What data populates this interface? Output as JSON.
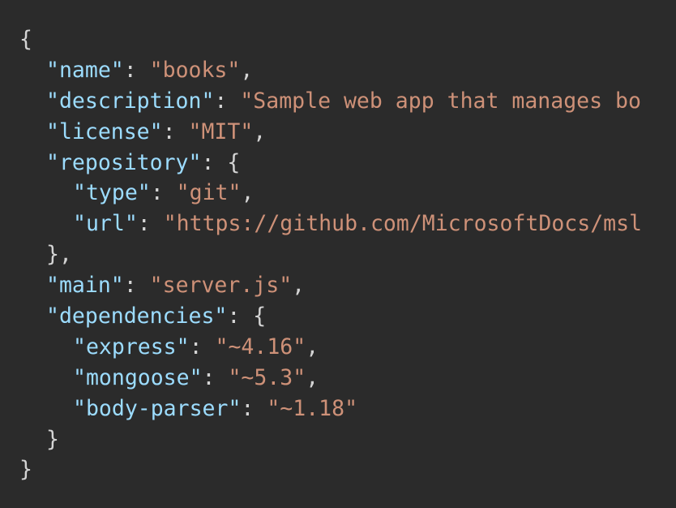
{
  "code": {
    "open_brace": "{",
    "close_brace": "}",
    "name_key": "\"name\"",
    "name_val": "\"books\"",
    "description_key": "\"description\"",
    "description_val": "\"Sample web app that manages bo",
    "license_key": "\"license\"",
    "license_val": "\"MIT\"",
    "repository_key": "\"repository\"",
    "type_key": "\"type\"",
    "type_val": "\"git\"",
    "url_key": "\"url\"",
    "url_val": "\"https://github.com/MicrosoftDocs/msl",
    "repository_close": "},",
    "main_key": "\"main\"",
    "main_val": "\"server.js\"",
    "dependencies_key": "\"dependencies\"",
    "express_key": "\"express\"",
    "express_val": "\"~4.16\"",
    "mongoose_key": "\"mongoose\"",
    "mongoose_val": "\"~5.3\"",
    "body_parser_key": "\"body-parser\"",
    "body_parser_val": "\"~1.18\"",
    "dependencies_close": "}"
  },
  "colors": {
    "background": "#2b2b2b",
    "key": "#9cdcfe",
    "string": "#ce9178",
    "punctuation": "#d4d4d4"
  }
}
